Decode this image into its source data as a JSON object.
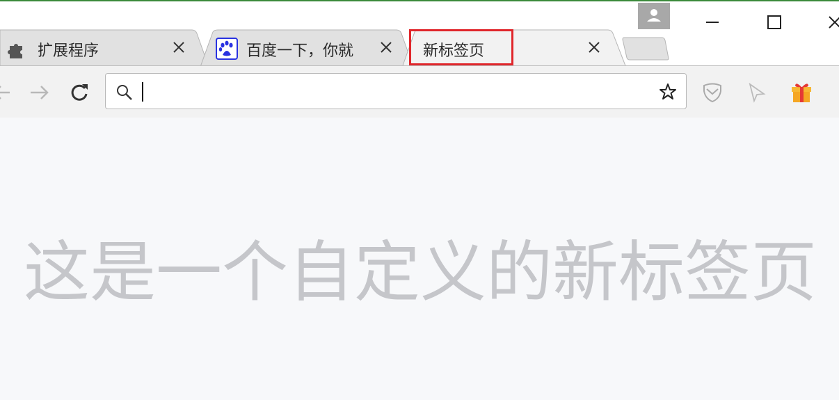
{
  "tabs": [
    {
      "title": "扩展程序",
      "icon": "puzzle-icon",
      "active": false
    },
    {
      "title": "百度一下，你就",
      "icon": "baidu-paw-icon",
      "active": false
    },
    {
      "title": "新标签页",
      "icon": "",
      "active": true
    }
  ],
  "window_controls": {
    "minimize": "—",
    "maximize": "☐",
    "close": "✕"
  },
  "toolbar": {
    "back_icon": "back-arrow-icon",
    "forward_icon": "forward-arrow-icon",
    "reload_icon": "reload-icon",
    "address_value": "",
    "bookmark_icon": "star-icon",
    "extensions": [
      "shield-icon",
      "cursor-icon",
      "gift-icon"
    ]
  },
  "content": {
    "headline": "这是一个自定义的新标签页"
  },
  "colors": {
    "highlight": "#e0262b",
    "headline": "#c5c6ca",
    "baidu_blue": "#2932e1"
  }
}
